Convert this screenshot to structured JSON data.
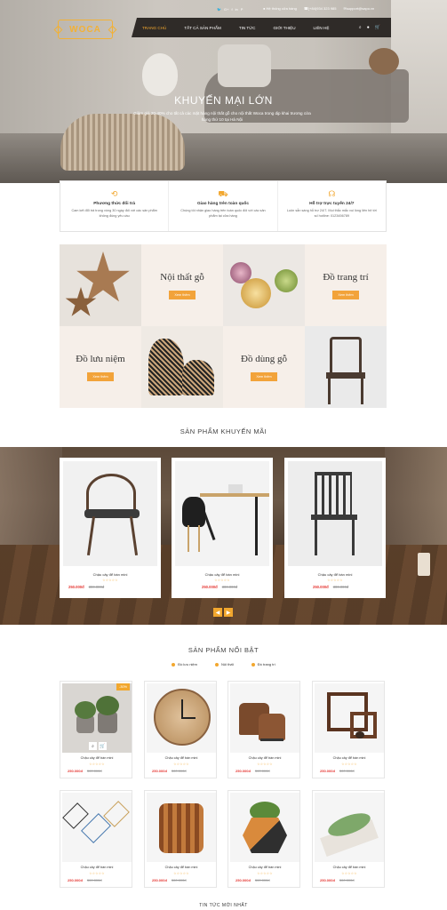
{
  "header": {
    "social": [
      "🐦",
      "G+",
      "f",
      "in",
      "P"
    ],
    "store_system": "Hệ thống cửa hàng",
    "phone": "(+84)934 323 985",
    "email": "support@sapo.vn",
    "logo": "WOCA",
    "nav": [
      "TRANG CHỦ",
      "TẤT CẢ SẢN PHẨM",
      "TIN TỨC",
      "GIỚI THIỆU",
      "LIÊN HỆ"
    ]
  },
  "hero": {
    "title": "KHUYẾN MẠI LỚN",
    "subtitle": "Giảm giá 20-40% cho tất cả các mặt hàng nội thất gỗ cho nội thất Woca trong dịp khai trương cửa hàng thứ 10 tại Hà Nội"
  },
  "features": [
    {
      "icon": "refresh-icon",
      "title": "Phương thức đổi trả",
      "desc": "Cam kết đổi trả trong vòng 30 ngày đối với các sản phẩm không đúng yêu cầu"
    },
    {
      "icon": "truck-icon",
      "title": "Giao hàng trên toàn quốc",
      "desc": "Chúng tôi nhận giao hàng trên toàn quốc đối với các sản phẩm tại cửa hàng"
    },
    {
      "icon": "headset-icon",
      "title": "Hỗ trợ trực tuyến 24/7",
      "desc": "Luôn sẵn sàng hỗ trợ 24/7. Mọi thắc mắc vui lòng liên hệ tới số hotline: 0123456789"
    }
  ],
  "categories": [
    {
      "name": "Nội thất gỗ",
      "button": "Xem thêm"
    },
    {
      "name": "Đồ trang trí",
      "button": "Xem thêm"
    },
    {
      "name": "Đồ lưu niệm",
      "button": "Xem thêm"
    },
    {
      "name": "Đồ dùng gỗ",
      "button": "Xem thêm"
    }
  ],
  "promo": {
    "title": "SẢN PHẨM KHUYẾN MÃI",
    "products": [
      {
        "name": "Chậu cây để bàn mini",
        "stars": "☆☆☆☆☆",
        "price": "250.000đ",
        "old_price": "300.000đ"
      },
      {
        "name": "Chậu cây để bàn mini",
        "stars": "☆☆☆☆☆",
        "price": "250.000đ",
        "old_price": "300.000đ"
      },
      {
        "name": "Chậu cây để bàn mini",
        "stars": "☆☆☆☆☆",
        "price": "250.000đ",
        "old_price": "300.000đ"
      }
    ],
    "prev": "◀",
    "next": "▶"
  },
  "featured": {
    "title": "SẢN PHẨM NỔI BẬT",
    "tabs": [
      "Đồ lưu niệm",
      "Nội thất",
      "Đồ trang trí"
    ],
    "sale_badge": "-30%",
    "products": [
      {
        "name": "Chậu cây để bàn mini",
        "stars": "☆☆☆☆☆",
        "price": "250.000đ",
        "old_price": "300.000đ"
      },
      {
        "name": "Chậu cây để bàn mini",
        "stars": "☆☆☆☆☆",
        "price": "250.000đ",
        "old_price": "300.000đ"
      },
      {
        "name": "Chậu cây để bàn mini",
        "stars": "☆☆☆☆☆",
        "price": "250.000đ",
        "old_price": "300.000đ"
      },
      {
        "name": "Chậu cây để bàn mini",
        "stars": "☆☆☆☆☆",
        "price": "250.000đ",
        "old_price": "300.000đ"
      },
      {
        "name": "Chậu cây để bàn mini",
        "stars": "☆☆☆☆☆",
        "price": "250.000đ",
        "old_price": "300.000đ"
      },
      {
        "name": "Chậu cây để bàn mini",
        "stars": "☆☆☆☆☆",
        "price": "250.000đ",
        "old_price": "300.000đ"
      },
      {
        "name": "Chậu cây để bàn mini",
        "stars": "☆☆☆☆☆",
        "price": "250.000đ",
        "old_price": "300.000đ"
      },
      {
        "name": "Chậu cây để bàn mini",
        "stars": "☆☆☆☆☆",
        "price": "250.000đ",
        "old_price": "300.000đ"
      }
    ]
  },
  "next_section_title": "TIN TỨC MỚI NHẤT",
  "colors": {
    "accent": "#f2a72e",
    "nav_bg": "#2f2b28",
    "price": "#e53935",
    "category_bg": "#f6efe9"
  }
}
